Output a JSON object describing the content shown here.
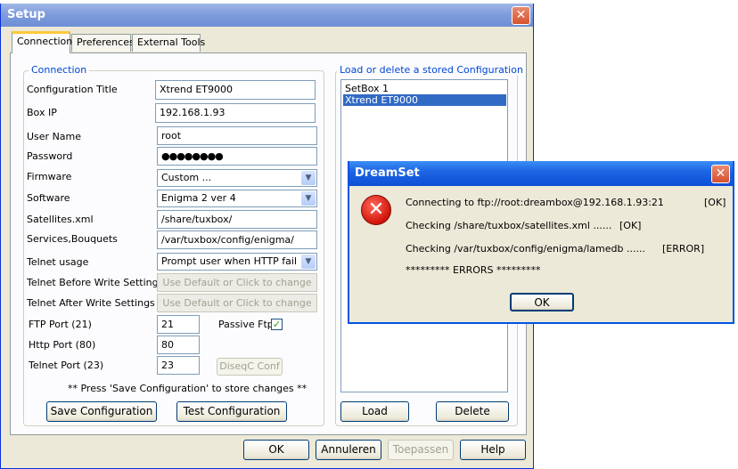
{
  "setup": {
    "title": "Setup",
    "close": "✕",
    "tabs": [
      "Connection",
      "Preferences",
      "External Tools"
    ],
    "connection": {
      "legend": "Connection",
      "config_title_label": "Configuration Title",
      "config_title_value": "Xtrend ET9000",
      "box_ip_label": "Box IP",
      "box_ip_value": "192.168.1.93",
      "user_name_label": "User Name",
      "user_name_value": "root",
      "password_label": "Password",
      "password_value": "●●●●●●●●",
      "firmware_label": "Firmware",
      "firmware_value": "Custom ...",
      "software_label": "Software",
      "software_value": "Enigma 2 ver 4",
      "satellites_label": "Satellites.xml",
      "satellites_value": "/share/tuxbox/",
      "services_label": "Services,Bouquets",
      "services_value": "/var/tuxbox/config/enigma/",
      "telnet_usage_label": "Telnet usage",
      "telnet_usage_value": "Prompt user when HTTP fail",
      "telnet_before_label": "Telnet Before Write Settings",
      "telnet_before_value": "Use Default or Click to change",
      "telnet_after_label": "Telnet After Write Settings",
      "telnet_after_value": "Use Default or Click to change",
      "ftp_port_label": "FTP Port (21)",
      "ftp_port_value": "21",
      "passive_ftp_label": "Passive Ftp",
      "passive_ftp_check": "✓",
      "http_port_label": "Http Port (80)",
      "http_port_value": "80",
      "telnet_port_label": "Telnet Port (23)",
      "telnet_port_value": "23",
      "diseqc_button": "DiseqC Conf",
      "hint": "** Press 'Save Configuration' to store changes **",
      "save_button": "Save Configuration",
      "test_button": "Test Configuration"
    },
    "stored": {
      "legend": "Load or delete a stored Configuration",
      "items": [
        "SetBox 1",
        "Xtrend ET9000"
      ],
      "load_button": "Load",
      "delete_button": "Delete"
    },
    "footer": {
      "ok": "OK",
      "cancel": "Annuleren",
      "apply": "Toepassen",
      "help": "Help"
    }
  },
  "dialog": {
    "title": "DreamSet",
    "close": "✕",
    "icon": "error-icon",
    "lines": [
      {
        "text": "Connecting to ftp://root:dreambox@192.168.1.93:21",
        "status": "[OK]"
      },
      {
        "text": "Checking  /share/tuxbox/satellites.xml ......",
        "status": "[OK]"
      },
      {
        "text": "Checking  /var/tuxbox/config/enigma/lamedb ......",
        "status": "[ERROR]"
      }
    ],
    "summary": "********* ERRORS *********",
    "ok_button": "OK"
  },
  "colors": {
    "titlebar_inactive": "#7f9ddc",
    "titlebar_active": "#1d66e3",
    "selection": "#316ac5",
    "group_legend": "#0046d5",
    "window_bg": "#ece9d8"
  }
}
